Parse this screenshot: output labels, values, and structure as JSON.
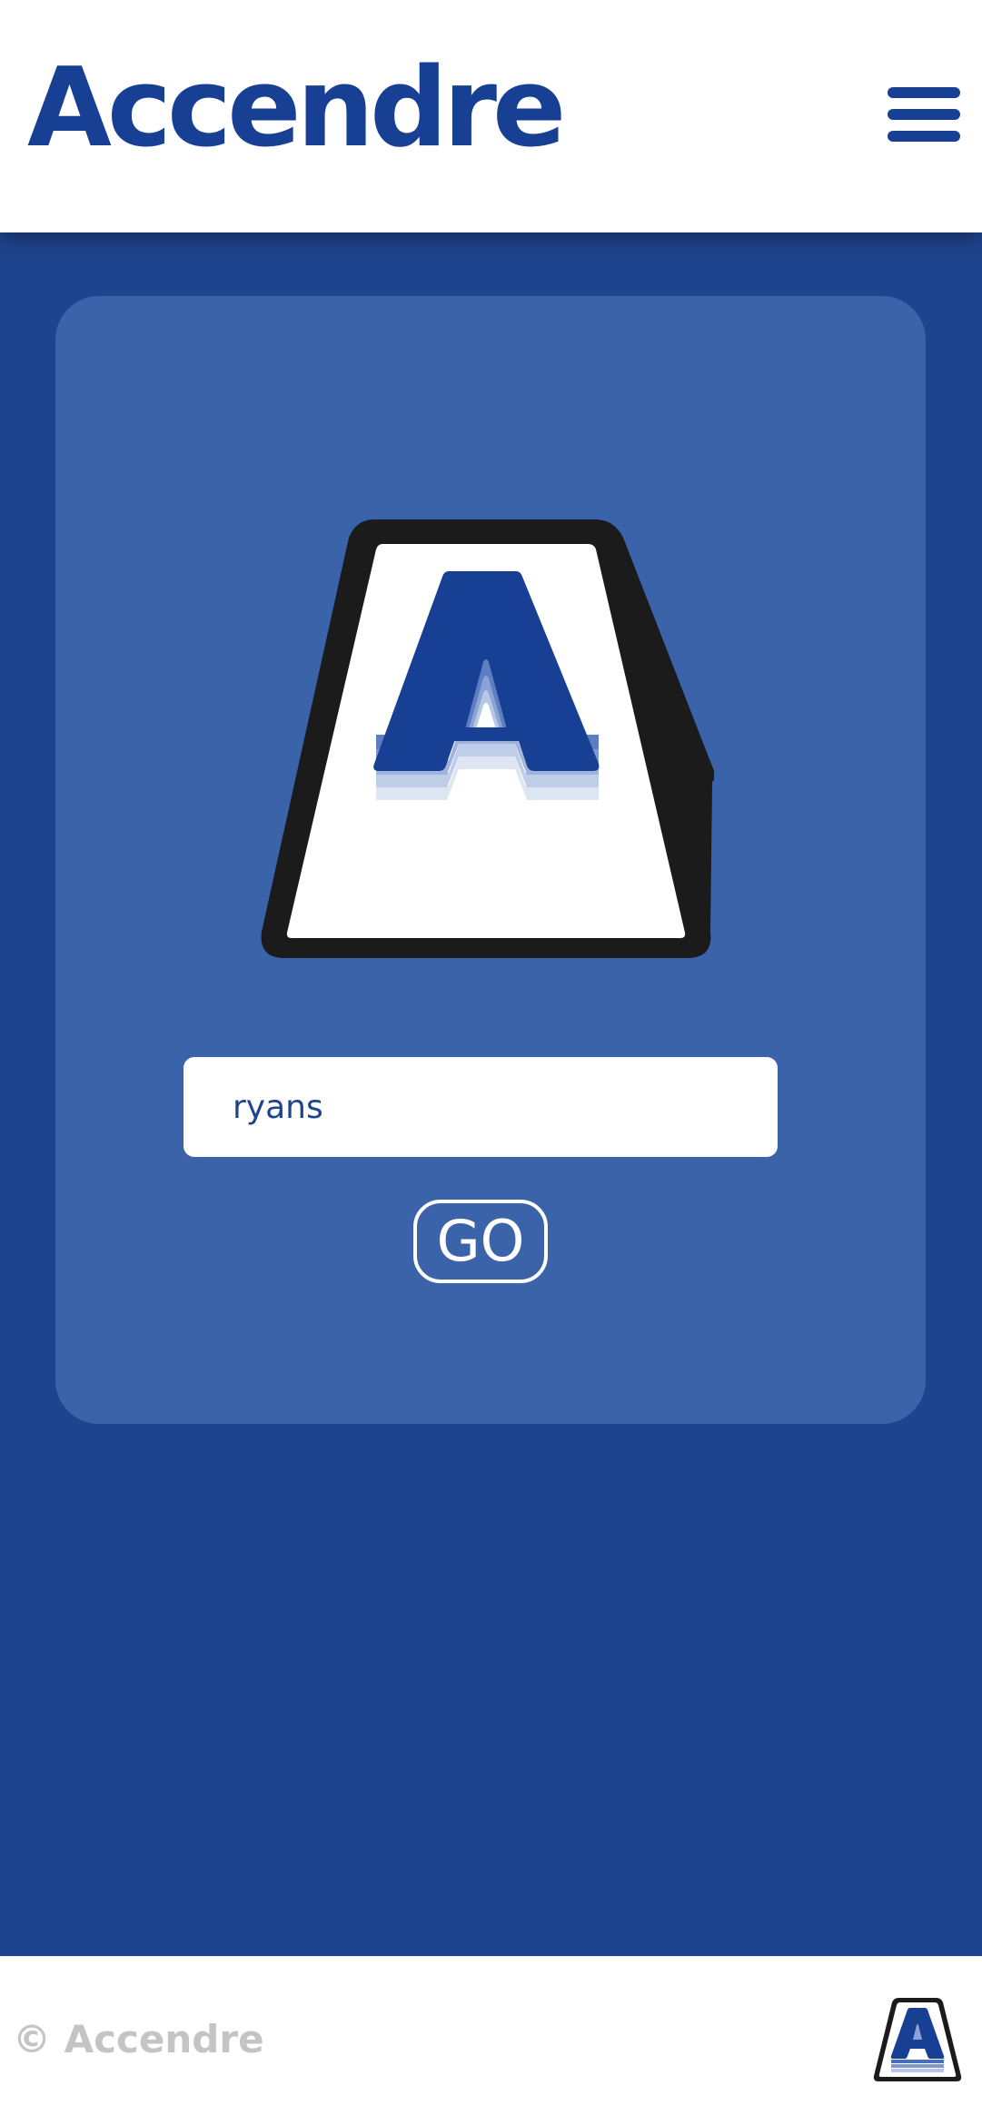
{
  "header": {
    "brand": "Accendre",
    "menu_icon": "hamburger-menu-icon"
  },
  "login": {
    "logo_icon": "accendre-a-logo-icon",
    "username_value": "ryans",
    "go_label": "GO"
  },
  "footer": {
    "copyright": "© Accendre",
    "logo_icon": "accendre-a-logo-icon"
  },
  "colors": {
    "brand_blue": "#173f94",
    "background": "#1f448f",
    "card": "#3b63aa",
    "footer_text": "#c4c4c4"
  }
}
